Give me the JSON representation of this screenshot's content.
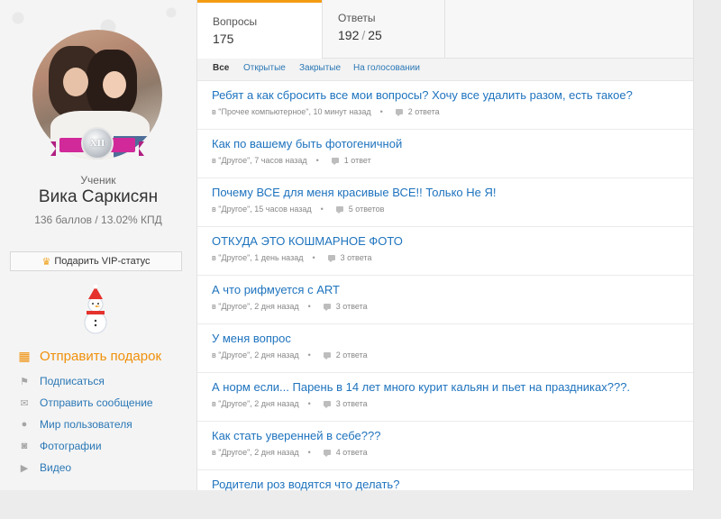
{
  "profile": {
    "medal_text": "XII",
    "rank": "Ученик",
    "name": "Вика Саркисян",
    "stats": "136 баллов / 13.02% КПД"
  },
  "vip_button": {
    "label": "Подарить VIP-статус",
    "icon": "crown-icon"
  },
  "menu": [
    {
      "label": "Отправить подарок",
      "icon": "gift-icon"
    },
    {
      "label": "Подписаться",
      "icon": "flag-icon"
    },
    {
      "label": "Отправить сообщение",
      "icon": "envelope-icon"
    },
    {
      "label": "Мир пользователя",
      "icon": "user-icon"
    },
    {
      "label": "Фотографии",
      "icon": "camera-icon"
    },
    {
      "label": "Видео",
      "icon": "video-icon"
    }
  ],
  "tabs": [
    {
      "label": "Вопросы",
      "count": "175"
    },
    {
      "label": "Ответы",
      "count_main": "192",
      "count_slash": "/",
      "count_sub": "25"
    }
  ],
  "filters": [
    "Все",
    "Открытые",
    "Закрытые",
    "На голосовании"
  ],
  "questions": [
    {
      "title": "Ребят а как сбросить все мои вопросы? Хочу все удалить разом, есть такое?",
      "meta": "в \"Прочее компьютерное\", 10 минут назад",
      "answers": "2 ответа"
    },
    {
      "title": "Как по вашему быть фотогеничной",
      "meta": "в \"Другое\", 7 часов назад",
      "answers": "1 ответ"
    },
    {
      "title": "Почему ВСЕ для меня красивые ВСЕ!! Только Не Я!",
      "meta": "в \"Другое\", 15 часов назад",
      "answers": "5 ответов"
    },
    {
      "title": "ОТКУДА ЭТО КОШМАРНОЕ ФОТО",
      "meta": "в \"Другое\", 1 день назад",
      "answers": "3 ответа"
    },
    {
      "title": "А что рифмуется с ART",
      "meta": "в \"Другое\", 2 дня назад",
      "answers": "3 ответа"
    },
    {
      "title": "У меня вопрос",
      "meta": "в \"Другое\", 2 дня назад",
      "answers": "2 ответа"
    },
    {
      "title": "А норм если... Парень в 14 лет много курит кальян и пьет на праздниках???.",
      "meta": "в \"Другое\", 2 дня назад",
      "answers": "3 ответа"
    },
    {
      "title": "Как стать уверенней в себе???",
      "meta": "в \"Другое\", 2 дня назад",
      "answers": "4 ответа"
    },
    {
      "title": "Родители роз водятся что делать?",
      "meta": "",
      "answers": ""
    }
  ],
  "colors": {
    "accent": "#f39c12",
    "link": "#1e73be",
    "gift": "#f0900a",
    "ribbon": "#d1299a"
  }
}
